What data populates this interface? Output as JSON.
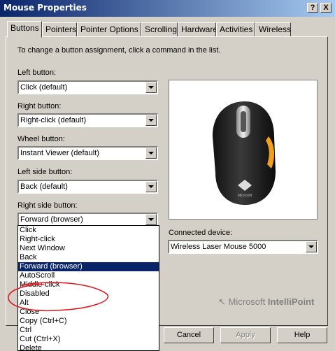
{
  "window": {
    "title": "Mouse Properties",
    "help_glyph": "?",
    "close_glyph": "X"
  },
  "tabs": [
    "Buttons",
    "Pointers",
    "Pointer Options",
    "Scrolling",
    "Hardware",
    "Activities",
    "Wireless"
  ],
  "instruction": "To change a button assignment, click a command in the list.",
  "buttons": {
    "left": {
      "label": "Left button:",
      "value": "Click (default)"
    },
    "right": {
      "label": "Right button:",
      "value": "Right-click (default)"
    },
    "wheel": {
      "label": "Wheel button:",
      "value": "Instant Viewer (default)"
    },
    "left_side": {
      "label": "Left side button:",
      "value": "Back (default)"
    },
    "right_side": {
      "label": "Right side button:",
      "value": "Forward (browser)"
    }
  },
  "dropdown_items": [
    "Click",
    "Right-click",
    "Next Window",
    "Back",
    "Forward (browser)",
    "AutoScroll",
    "Middle-click",
    "Disabled",
    "Alt",
    "Close",
    "Copy (Ctrl+C)",
    "Ctrl",
    "Cut (Ctrl+X)",
    "Delete"
  ],
  "dropdown_selected": "Forward (browser)",
  "device": {
    "label": "Connected device:",
    "value": "Wireless Laser Mouse 5000"
  },
  "mouse_brand_text": "Microsoft",
  "brand": {
    "company": "Microsoft",
    "product": "IntelliPoint"
  },
  "footer": {
    "cancel": "Cancel",
    "apply": "Apply",
    "help": "Help"
  },
  "colors": {
    "titlebar_start": "#0a246a",
    "titlebar_end": "#a6caf0",
    "selection": "#0a246a",
    "annotation": "#e0141e",
    "mouse_accent": "#f0a020"
  }
}
